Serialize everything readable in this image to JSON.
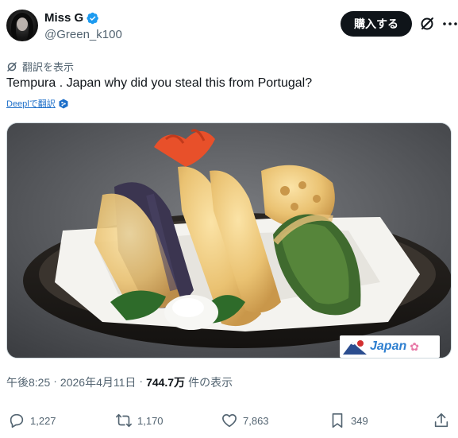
{
  "author": {
    "display_name": "Miss G",
    "handle": "@Green_k100",
    "verified": true
  },
  "header": {
    "buy_label": "購入する",
    "grok_icon": "slash-circle-icon",
    "more_icon": "more-dots-icon"
  },
  "translate": {
    "label": "翻訳を表示",
    "deepl_label": "Deeplで翻訳"
  },
  "tweet": {
    "text": "Tempura . Japan why did you steal this from Portugal?"
  },
  "media": {
    "watermark_text": "Japan"
  },
  "meta": {
    "time": "午後8:25",
    "date": "2026年4月11日",
    "separator": "·",
    "views_count": "744.7万",
    "views_label": "件の表示"
  },
  "actions": {
    "reply_count": "1,227",
    "repost_count": "1,170",
    "like_count": "7,863",
    "bookmark_count": "349"
  },
  "colors": {
    "accent": "#1d9bf0",
    "text_primary": "#0f1419",
    "text_secondary": "#536471",
    "button_bg": "#0f1419"
  }
}
